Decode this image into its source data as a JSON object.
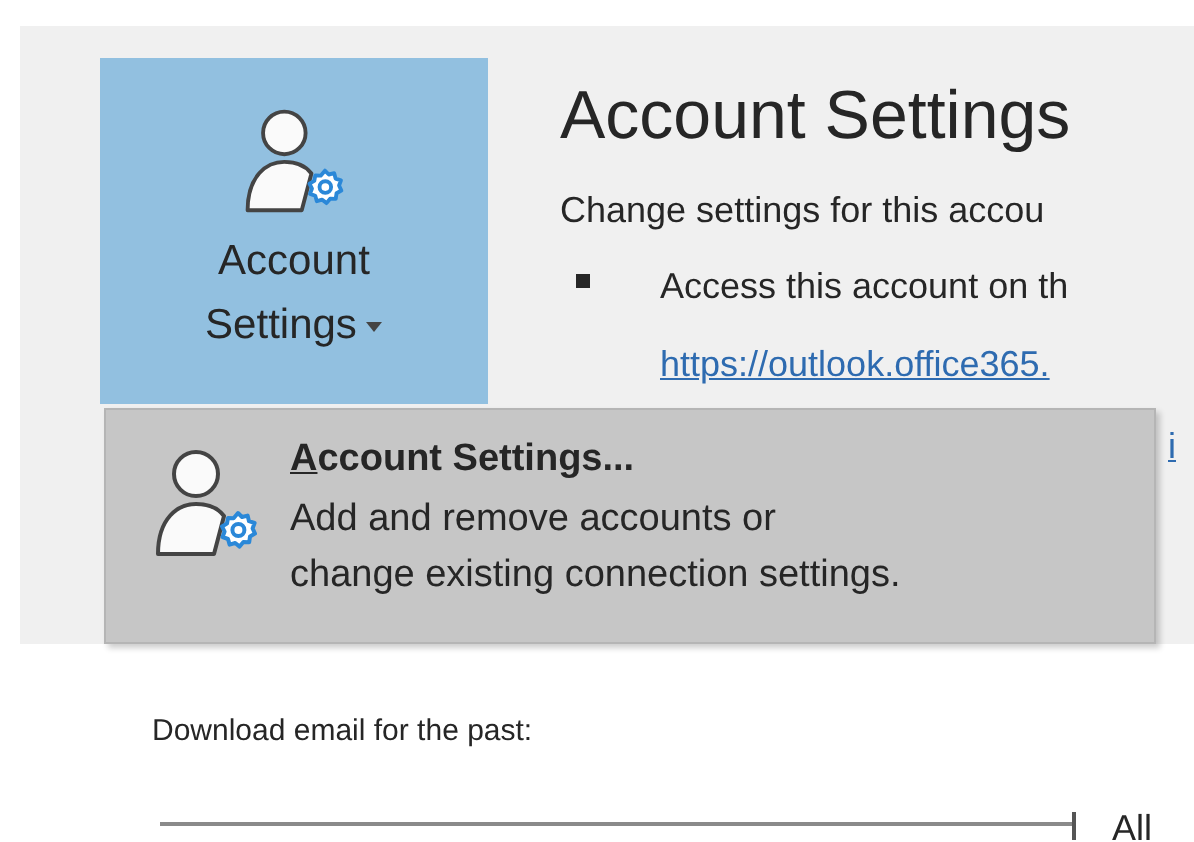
{
  "ribbon_button": {
    "label_line_1": "Account",
    "label_line_2": "Settings",
    "expanded": true
  },
  "heading": "Account Settings",
  "description": "Change settings for this accou",
  "bullets": [
    {
      "text": "Access this account on th",
      "link": "https://outlook.office365."
    }
  ],
  "partial_link": "i",
  "menu": {
    "items": [
      {
        "title": "Account Settings...",
        "description_line_1": "Add and remove accounts or",
        "description_line_2": "change existing connection settings.",
        "selected": true
      }
    ]
  },
  "download": {
    "label": "Download email for the past:",
    "level": 1,
    "reading": "All"
  }
}
